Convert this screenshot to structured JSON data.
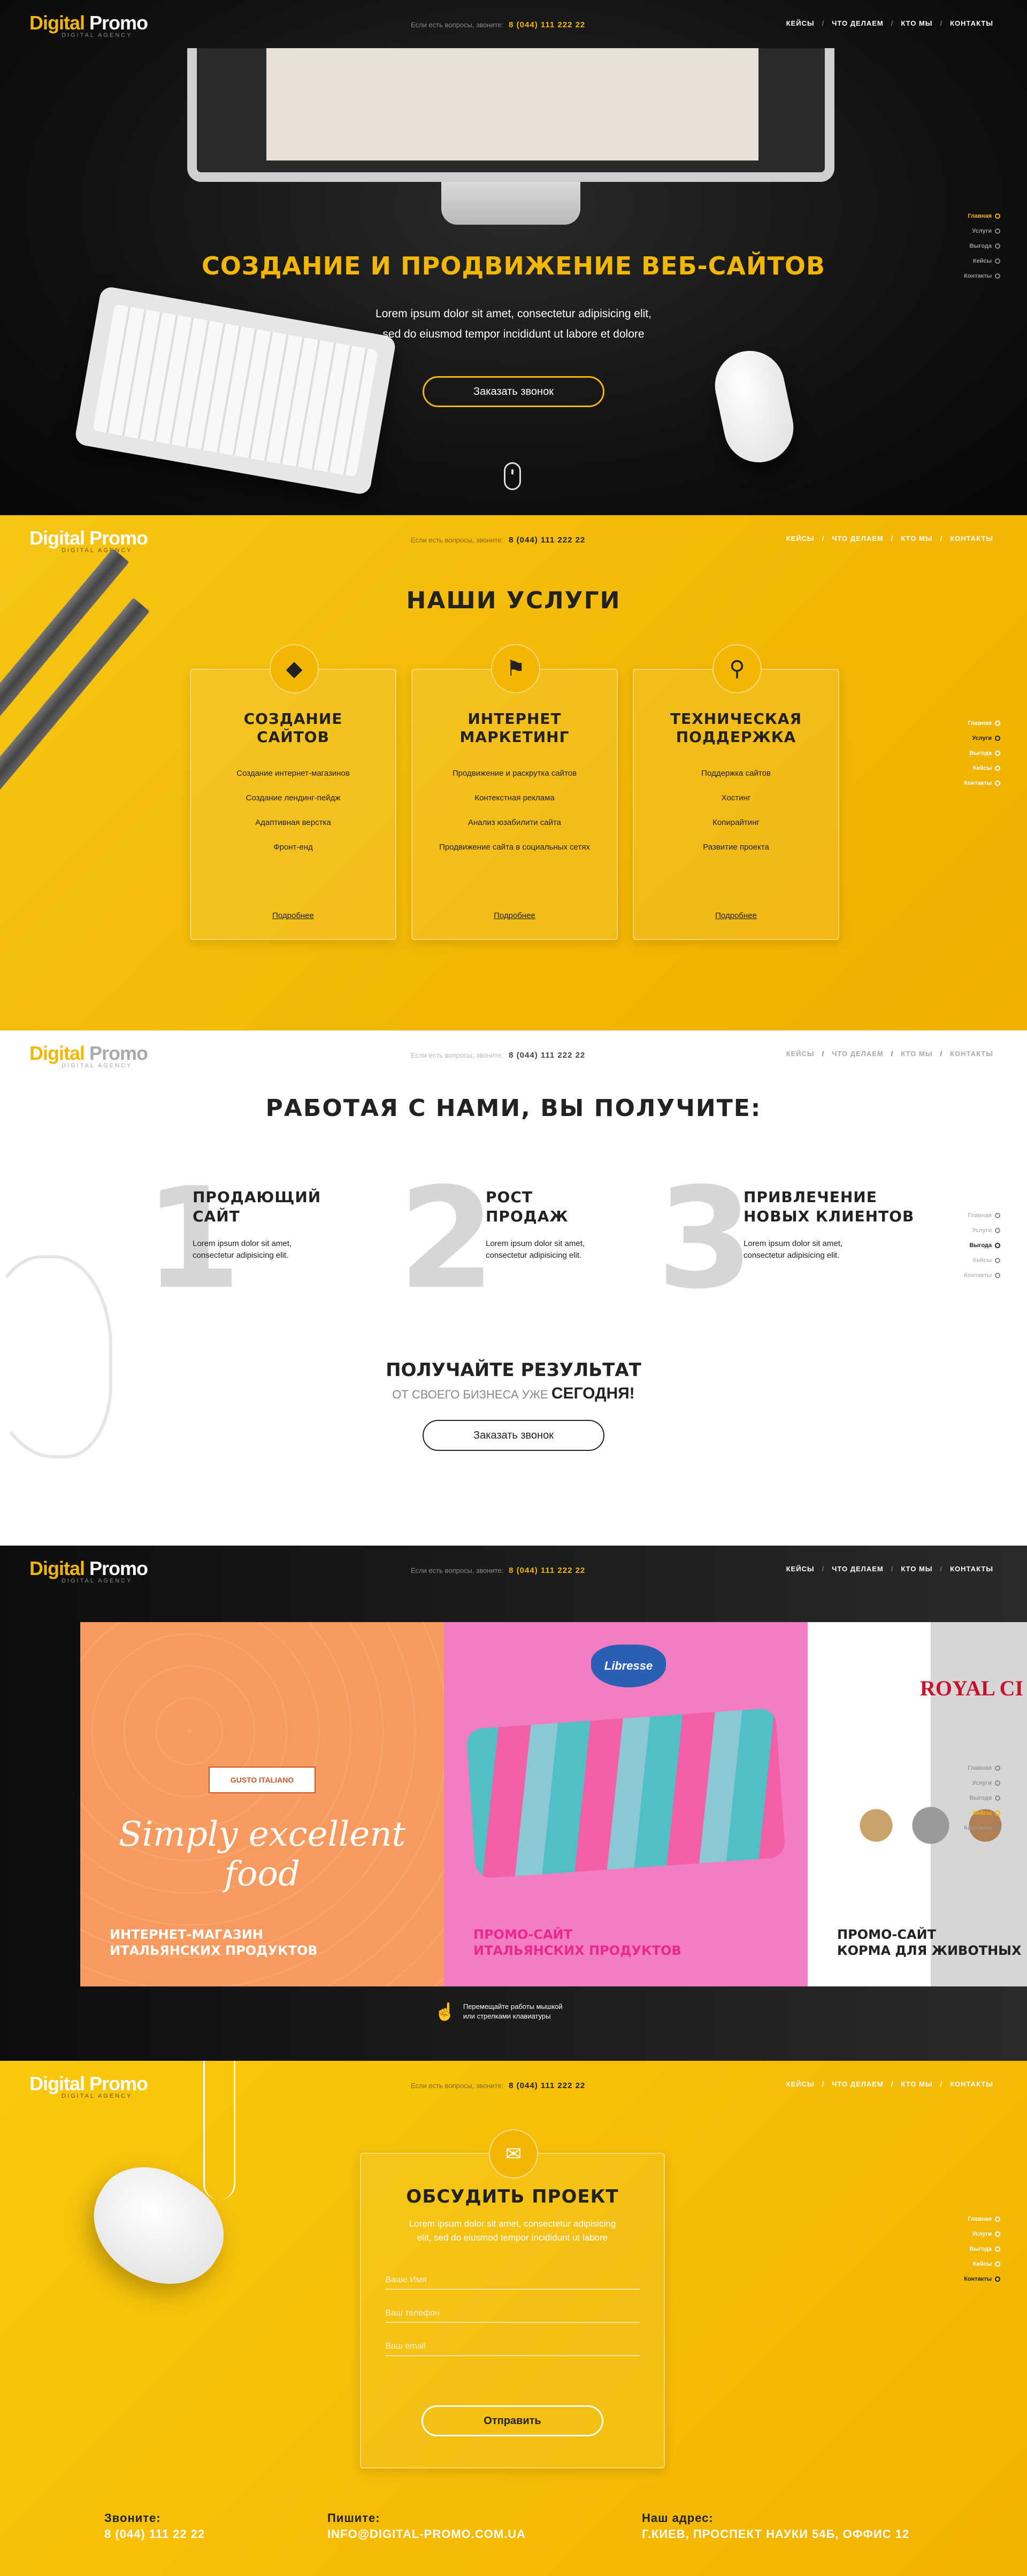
{
  "header": {
    "logo_main_1": "Digital",
    "logo_main_2": "Promo",
    "logo_sub": "DIGITAL AGENCY",
    "phone_prompt": "Если есть вопросы, звоните:",
    "phone": "8 (044) 111 222 22",
    "nav": [
      "КЕЙСЫ",
      "ЧТО ДЕЛАЕМ",
      "КТО МЫ",
      "КОНТАКТЫ"
    ],
    "nav_sep": "/"
  },
  "sidenav": [
    "Главная",
    "Услуги",
    "Выгода",
    "Кейсы",
    "Контакты"
  ],
  "hero": {
    "title": "СОЗДАНИЕ И ПРОДВИЖЕНИЕ ВЕБ-САЙТОВ",
    "text_line1": "Lorem ipsum dolor sit amet, consectetur adipisicing elit,",
    "text_line2": "sed do eiusmod tempor incididunt ut labore et dolore",
    "button": "Заказать звонок"
  },
  "services": {
    "title": "НАШИ УСЛУГИ",
    "cards": [
      {
        "icon": "diamond-icon",
        "title_line1": "СОЗДАНИЕ",
        "title_line2": "САЙТОВ",
        "items": [
          "Создание интернет-магазинов",
          "Создание лендинг-пейдж",
          "Адаптивная верстка",
          "Фронт-енд"
        ],
        "more": "Подробнее"
      },
      {
        "icon": "megaphone-icon",
        "title_line1": "ИНТЕРНЕТ",
        "title_line2": "МАРКЕТИНГ",
        "items": [
          "Продвижение и раскрутка сайтов",
          "Контекстная реклама",
          "Анализ юзабилити сайта",
          "Продвижение сайта в социальных сетях"
        ],
        "more": "Подробнее"
      },
      {
        "icon": "magnifier-icon",
        "title_line1": "ТЕХНИЧЕСКАЯ",
        "title_line2": "ПОДДЕРЖКА",
        "items": [
          "Поддержка сайтов",
          "Хостинг",
          "Копирайтинг",
          "Развитие проекта"
        ],
        "more": "Подробнее"
      }
    ]
  },
  "benefits": {
    "title": "РАБОТАЯ С НАМИ, ВЫ ПОЛУЧИТЕ:",
    "items": [
      {
        "num": "1",
        "title_line1": "ПРОДАЮЩИЙ",
        "title_line2": "САЙТ",
        "text_line1": "Lorem ipsum dolor sit amet,",
        "text_line2": "consectetur adipisicing elit."
      },
      {
        "num": "2",
        "title_line1": "РОСТ",
        "title_line2": "ПРОДАЖ",
        "text_line1": "Lorem ipsum dolor sit amet,",
        "text_line2": "consectetur adipisicing elit."
      },
      {
        "num": "3",
        "title_line1": "ПРИВЛЕЧЕНИЕ",
        "title_line2": "НОВЫХ КЛИЕНТОВ",
        "text_line1": "Lorem ipsum dolor sit amet,",
        "text_line2": "consectetur adipisicing elit."
      }
    ],
    "result_title": "ПОЛУЧАЙТЕ РЕЗУЛЬТАТ",
    "result_sub": "ОТ СВОЕГО БИЗНЕСА УЖЕ",
    "result_sub_bold": "СЕГОДНЯ!",
    "button": "Заказать звонок"
  },
  "cases": {
    "items": [
      {
        "caption_line1": "ИНТЕРНЕТ-МАГАЗИН",
        "caption_line2": "ИТАЛЬЯНСКИХ ПРОДУКТОВ",
        "script": "Simply excellent food",
        "ribbon": "GUSTO ITALIANO"
      },
      {
        "caption_line1": "ПРОМО-САЙТ",
        "caption_line2": "ИТАЛЬЯНСКИХ ПРОДУКТОВ",
        "brand": "Libresse"
      },
      {
        "caption_line1": "ПРОМО-САЙТ",
        "caption_line2": "КОРМА ДЛЯ ЖИВОТНЫХ",
        "brand": "ROYAL CI"
      }
    ],
    "hint_line1": "Перемещайте работы мышкой",
    "hint_line2": "или стрелками клавиатуры"
  },
  "contact": {
    "title": "ОБСУДИТЬ ПРОЕКТ",
    "intro_line1": "Lorem ipsum dolor sit amet, consectetur adipisicing",
    "intro_line2": "elit, sed do eiusmod tempor incididunt ut labore",
    "name_placeholder": "Ваше Имя",
    "phone_placeholder": "Ваш телефон",
    "email_placeholder": "Ваш email",
    "submit": "Отправить"
  },
  "footer": {
    "call_label": "Звоните:",
    "call_value": "8 (044) 111 22 22",
    "write_label": "Пишите:",
    "write_value": "INFO@DIGITAL-PROMO.COM.UA",
    "address_label": "Наш адрес:",
    "address_value": "Г.КИЕВ, ПРОСПЕКТ НАУКИ 54Б, ОФФИС 12"
  },
  "colors": {
    "accent": "#f2b705",
    "dark": "#111111",
    "pink": "#e8288d",
    "orange": "#f79a5f"
  }
}
